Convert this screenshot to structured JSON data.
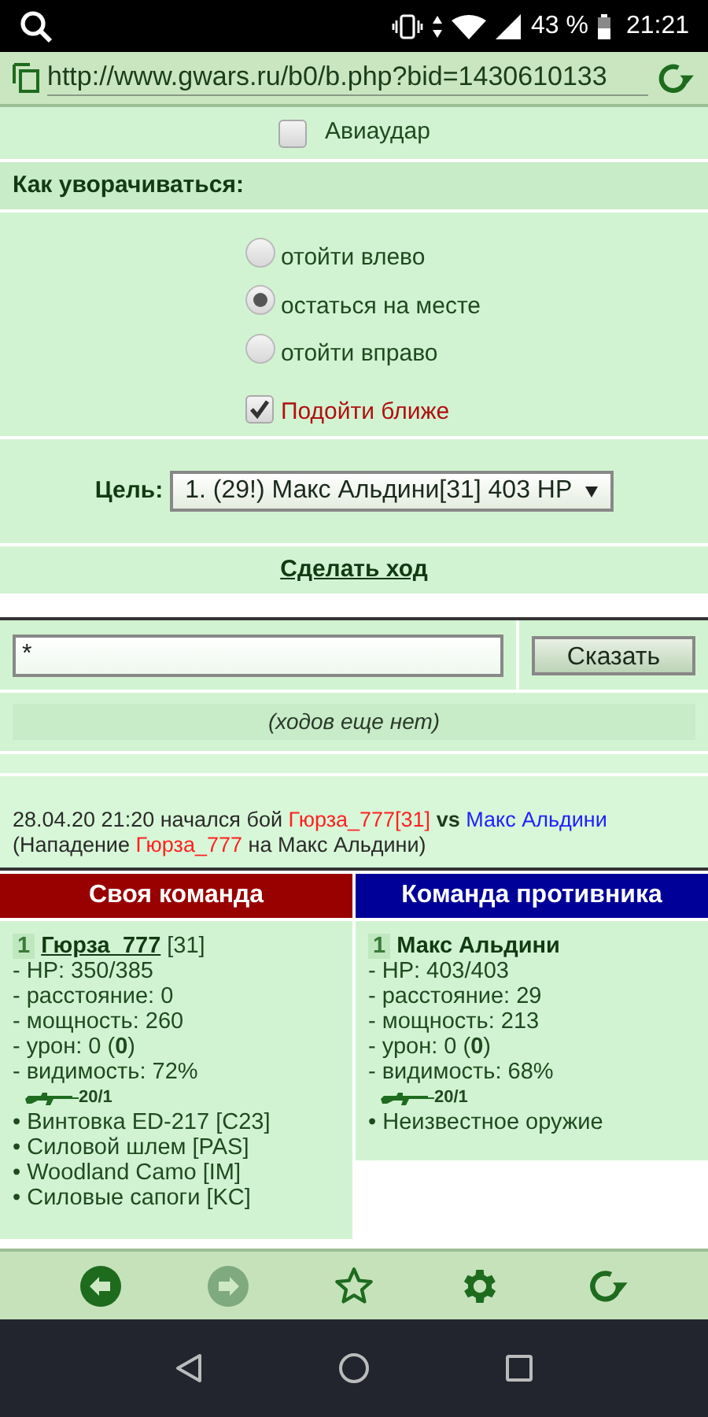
{
  "status_bar": {
    "battery": "43 %",
    "time": "21:21"
  },
  "address_bar": {
    "url": "http://www.gwars.ru/b0/b.php?bid=1430610133"
  },
  "airstrike": {
    "label": "Авиаудар",
    "checked": false
  },
  "dodge": {
    "title": "Как уворачиваться:",
    "options": [
      {
        "label": "отойти влево",
        "selected": false
      },
      {
        "label": "остаться на месте",
        "selected": true
      },
      {
        "label": "отойти вправо",
        "selected": false
      }
    ],
    "approach": {
      "label": "Подойти ближе",
      "checked": true
    }
  },
  "target": {
    "label": "Цель:",
    "value": "1. (29!) Макс Альдини[31] 403 HP"
  },
  "make_move": "Сделать ход",
  "chat": {
    "value": "*",
    "button": "Сказать"
  },
  "moves_note": "(ходов еще нет)",
  "log": [
    [
      {
        "kind": "plain",
        "text": "28.04.20 21:20 начался бой"
      },
      {
        "kind": "own",
        "text": "Гюрза_777[31]"
      },
      {
        "kind": "bold",
        "text": "vs"
      },
      {
        "kind": "enemy",
        "text": "Макс Альдини"
      }
    ],
    [
      {
        "kind": "plain",
        "text": "(Нападение"
      },
      {
        "kind": "own",
        "text": "Гюрза_777"
      },
      {
        "kind": "plain",
        "text": "на Макс Альдини)"
      }
    ]
  ],
  "teams": [
    {
      "title": "Своя команда",
      "kind": "own",
      "members": [
        {
          "number": "1",
          "name": "Гюрза_777",
          "link": true,
          "level": "[31]",
          "stats": [
            "- HP: 350/385",
            "- расстояние: 0",
            "- мощность: 260",
            "- урон: 0 (**0**)",
            "- видимость: 72%"
          ],
          "ammo": "20/1",
          "items": [
            "• Винтовка ED-217 [C23]",
            "• Силовой шлем [PAS]",
            "• Woodland Camo [IM]",
            "• Силовые сапоги [KC]"
          ]
        }
      ]
    },
    {
      "title": "Команда противника",
      "kind": "enemy",
      "members": [
        {
          "number": "1",
          "name": "Макс Альдини",
          "link": false,
          "stats": [
            "- HP: 403/403",
            "- расстояние: 29",
            "- мощность: 213",
            "- урон: 0 (**0**)",
            "- видимость: 68%"
          ],
          "ammo": "20/1",
          "items": [
            "• Неизвестное оружие"
          ]
        }
      ]
    }
  ],
  "toolbar": [
    {
      "kind": "back",
      "disabled": false
    },
    {
      "kind": "forward",
      "disabled": true
    },
    {
      "kind": "bookmark",
      "disabled": false
    },
    {
      "kind": "settings",
      "disabled": false
    },
    {
      "kind": "reload",
      "disabled": false
    }
  ]
}
